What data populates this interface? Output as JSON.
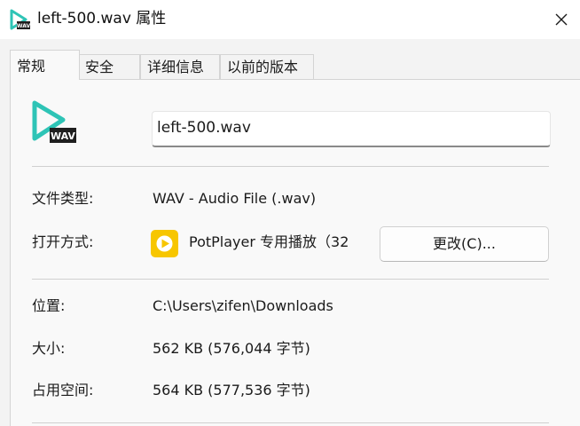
{
  "window": {
    "title": "left-500.wav 属性",
    "close_glyph": "✕",
    "icon": "wav-file-icon"
  },
  "tabs": [
    {
      "label": "常规",
      "active": true
    },
    {
      "label": "安全",
      "active": false
    },
    {
      "label": "详细信息",
      "active": false
    },
    {
      "label": "以前的版本",
      "active": false
    }
  ],
  "general": {
    "file_name": "left-500.wav",
    "file_icon": "wav-file-icon",
    "file_icon_badge": "WAV",
    "file_type": {
      "label": "文件类型:",
      "value": "WAV - Audio File (.wav)"
    },
    "opens_with": {
      "label": "打开方式:",
      "app_name": "PotPlayer 专用播放（32",
      "app_icon": "potplayer-icon",
      "change_button": "更改(C)..."
    },
    "location": {
      "label": "位置:",
      "value": "C:\\Users\\zifen\\Downloads"
    },
    "size": {
      "label": "大小:",
      "value": "562 KB (576,044 字节)"
    },
    "size_on_disk": {
      "label": "占用空间:",
      "value": "564 KB (577,536 字节)"
    }
  },
  "colors": {
    "accent_teal": "#2ec4b6",
    "potplayer_yellow": "#f7c600",
    "badge_dark": "#1f1f1f"
  }
}
